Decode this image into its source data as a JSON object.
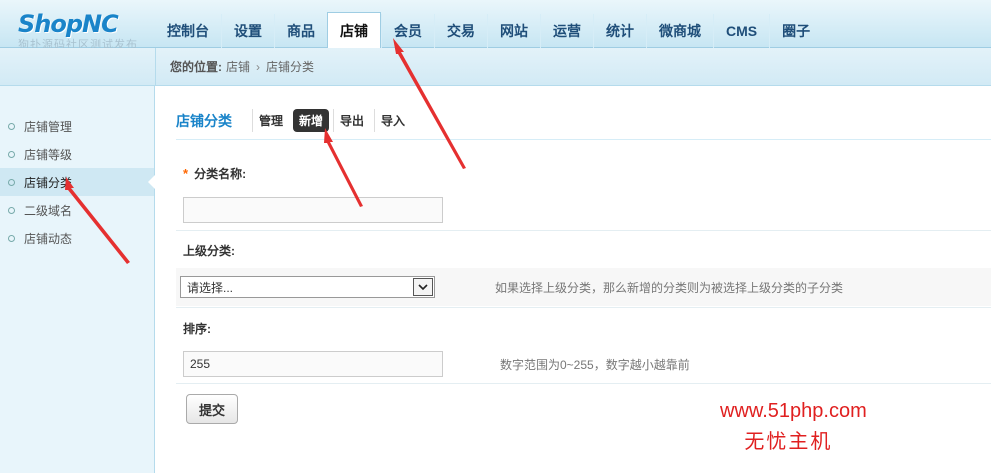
{
  "logo": {
    "brand": "ShopNC",
    "subtitle": "狗扑源码社区测试发布"
  },
  "nav": {
    "items": [
      {
        "label": "控制台"
      },
      {
        "label": "设置"
      },
      {
        "label": "商品"
      },
      {
        "label": "店铺",
        "active": true
      },
      {
        "label": "会员"
      },
      {
        "label": "交易"
      },
      {
        "label": "网站"
      },
      {
        "label": "运营"
      },
      {
        "label": "统计"
      },
      {
        "label": "微商城"
      },
      {
        "label": "CMS"
      },
      {
        "label": "圈子"
      }
    ]
  },
  "breadcrumb": {
    "prefix": "您的位置:",
    "level1": "店铺",
    "separator": "›",
    "level2": "店铺分类"
  },
  "sidebar": {
    "items": [
      {
        "label": "店铺管理"
      },
      {
        "label": "店铺等级"
      },
      {
        "label": "店铺分类",
        "active": true
      },
      {
        "label": "二级域名"
      },
      {
        "label": "店铺动态"
      }
    ]
  },
  "tabs": {
    "title": "店铺分类",
    "items": [
      {
        "label": "管理"
      },
      {
        "label": "新增",
        "current": true
      },
      {
        "label": "导出"
      },
      {
        "label": "导入"
      }
    ]
  },
  "form": {
    "required_mark": "*",
    "name_label": "分类名称:",
    "name_value": "",
    "parent_label": "上级分类:",
    "parent_selected": "请选择...",
    "parent_hint": "如果选择上级分类，那么新增的分类则为被选择上级分类的子分类",
    "sort_label": "排序:",
    "sort_value": "255",
    "sort_hint": "数字范围为0~255，数字越小越靠前",
    "submit_label": "提交"
  },
  "watermark": {
    "line1": "www.51php.com",
    "line2": "无忧主机"
  },
  "colors": {
    "accent": "#1a84c9",
    "annotation": "#e02020",
    "required": "#ff6600"
  }
}
